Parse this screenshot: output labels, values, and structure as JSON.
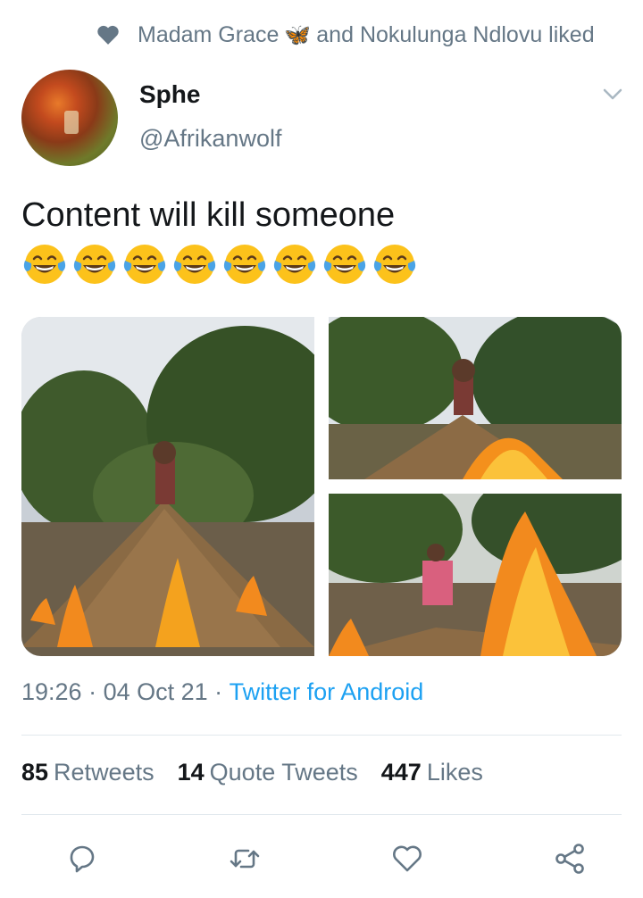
{
  "social_context": {
    "icon": "heart-icon",
    "name_1": "Madam Grace",
    "emoji": "🦋",
    "rest": "and Nokulunga Ndlovu liked"
  },
  "author": {
    "display_name": "Sphe",
    "handle": "@Afrikanwolf"
  },
  "tweet": {
    "text": "Content will kill someone",
    "emoji_count": 8,
    "emoji": "face-with-tears-of-joy"
  },
  "media": [
    {
      "alt": "photo-1"
    },
    {
      "alt": "photo-2"
    },
    {
      "alt": "photo-3"
    }
  ],
  "meta": {
    "time": "19:26",
    "sep1": " · ",
    "date": "04 Oct 21",
    "sep2": " · ",
    "source": "Twitter for Android"
  },
  "stats": {
    "retweets_count": "85",
    "retweets_label": "Retweets",
    "quotes_count": "14",
    "quotes_label": "Quote Tweets",
    "likes_count": "447",
    "likes_label": "Likes"
  },
  "actions": [
    "reply-icon",
    "retweet-icon",
    "like-icon",
    "share-icon"
  ],
  "colors": {
    "text": "#14171a",
    "secondary": "#657786",
    "link": "#1da1f2",
    "divider": "#e1e8ed"
  }
}
